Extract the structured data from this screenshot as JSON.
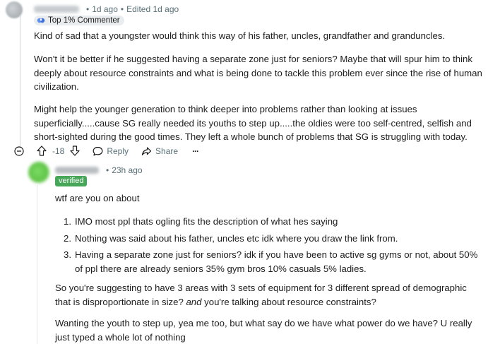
{
  "comment1": {
    "time": "1d ago",
    "edited": "Edited 1d ago",
    "badge": "Top 1% Commenter",
    "paragraphs": [
      "Kind of sad that a youngster would think this way of his father, uncles, grandfather and granduncles.",
      "Won't it be better if he suggested having a separate zone just for seniors? Maybe that will spur him to think deeply about resource constraints and what is being done to tackle this problem ever since the rise of human civilization.",
      "Might help the younger generation to think deeper into problems rather than looking at issues superficially.....cause SG really needed its youths to step up.....the oldies were too self-centred, selfish and short-sighted during the good times. They left a whole bunch of problems that SG is struggling with today."
    ],
    "actions": {
      "score": "-18",
      "reply": "Reply",
      "share": "Share",
      "more": "···"
    }
  },
  "comment2": {
    "time": "23h ago",
    "flair": "verified",
    "intro": "wtf are you on about",
    "list": [
      "IMO most ppl thats ogling fits the description of what hes saying",
      "Nothing was said about his father, uncles etc idk where you draw the link from.",
      "Having a separate zone just for seniors? idk if you have been to active sg gyms or not, about 50% of ppl there are already seniors 35% gym bros 10% casuals 5% ladies."
    ],
    "para2_before": "So you're suggesting to have 3 areas with 3 sets of equipment for 3 different spread of demographic that is disproportionate in size? ",
    "para2_em": "and",
    "para2_after": " you're talking about resource constraints?",
    "para3": "Wanting the youth to step up, yea me too, but what say do we have what power do we have? U really just typed a whole lot of nothing"
  },
  "colors": {
    "meta": "#576f76",
    "flair_bg": "#46a758",
    "badge_bg": "#eaedef"
  }
}
